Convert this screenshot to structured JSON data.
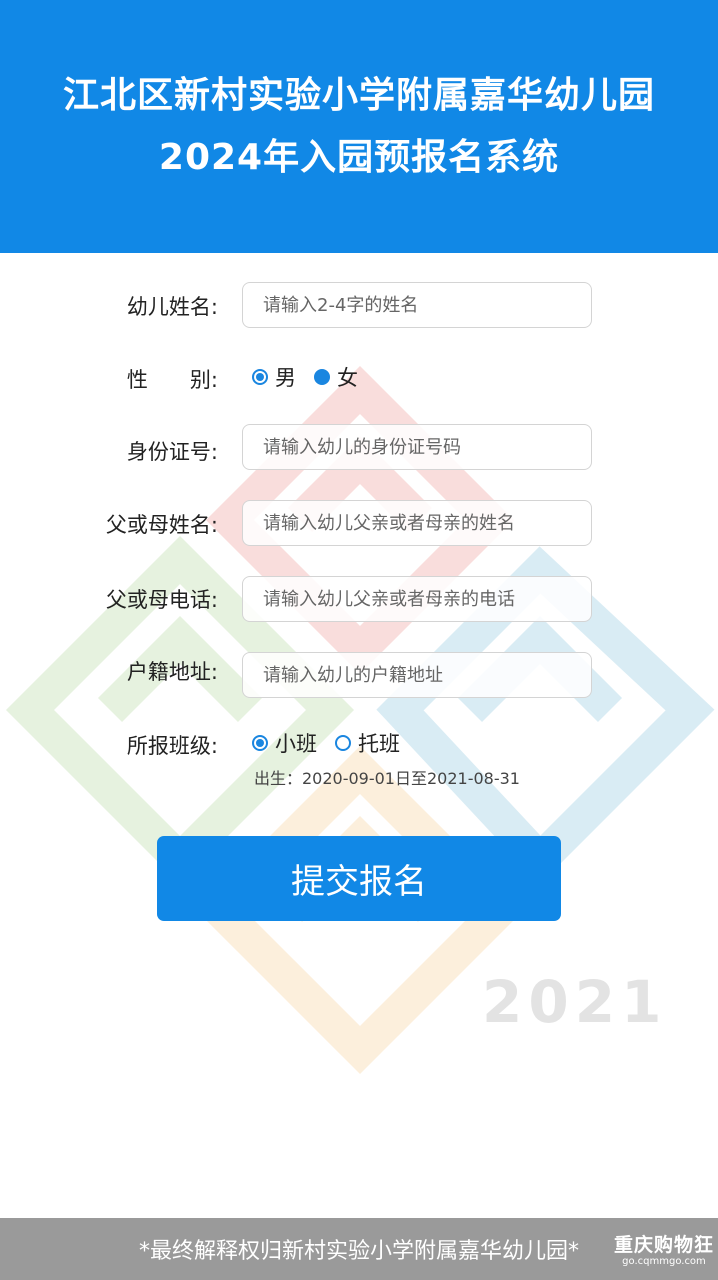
{
  "header": {
    "title_line1": "江北区新村实验小学附属嘉华幼儿园",
    "title_line2": "2024年入园预报名系统"
  },
  "background": {
    "watermark_year": "2021"
  },
  "form": {
    "child_name": {
      "label": "幼儿姓名:",
      "placeholder": "请输入2-4字的姓名",
      "value": ""
    },
    "gender": {
      "label": "性　　别:",
      "options": [
        {
          "label": "男",
          "selected": true
        },
        {
          "label": "女",
          "selected": false
        }
      ]
    },
    "id_number": {
      "label": "身份证号:",
      "placeholder": "请输入幼儿的身份证号码",
      "value": ""
    },
    "parent_name": {
      "label": "父或母姓名:",
      "placeholder": "请输入幼儿父亲或者母亲的姓名",
      "value": ""
    },
    "parent_phone": {
      "label": "父或母电话:",
      "placeholder": "请输入幼儿父亲或者母亲的电话",
      "value": ""
    },
    "household_address": {
      "label": "户籍地址:",
      "placeholder": "请输入幼儿的户籍地址",
      "value": ""
    },
    "class": {
      "label": "所报班级:",
      "options": [
        {
          "label": "小班",
          "selected": true
        },
        {
          "label": "托班",
          "selected": false
        }
      ],
      "birth_range": "出生：2020-09-01日至2021-08-31"
    },
    "submit_label": "提交报名"
  },
  "footer": {
    "note": "*最终解释权归新村实验小学附属嘉华幼儿园*",
    "brand_name": "重庆购物狂",
    "brand_url": "go.cqmmgo.com"
  },
  "colors": {
    "primary": "#1188e6",
    "footer_bg": "#9a9a9a",
    "art_red": "#e0342a",
    "art_green": "#6cb33e",
    "art_blue": "#1d8fc0",
    "art_yellow": "#f2a22c"
  }
}
